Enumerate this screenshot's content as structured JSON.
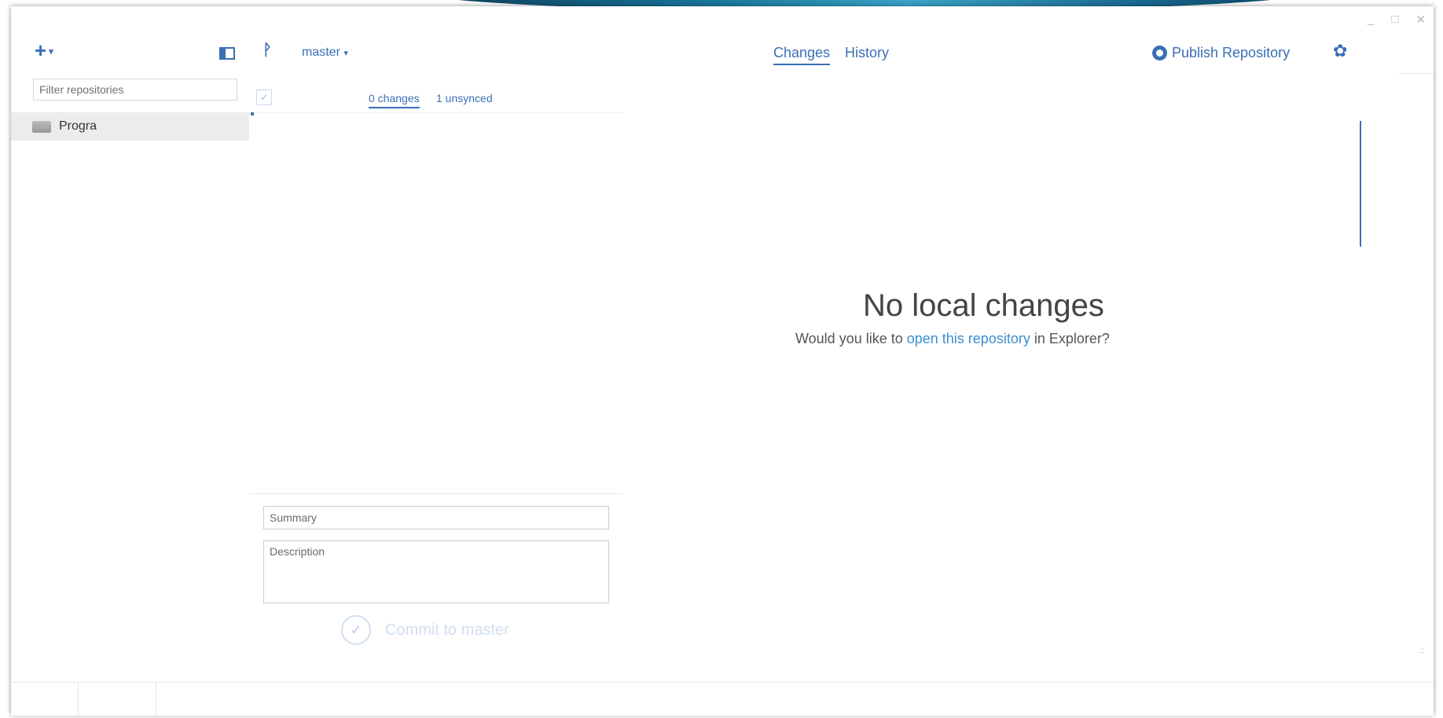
{
  "window_controls": {
    "minimize": "_",
    "maximize": "□",
    "close": "✕"
  },
  "sidebar": {
    "add_button": "+",
    "add_caret": "▾",
    "filter_placeholder": "Filter repositories",
    "repositories": [
      {
        "label": "Progra",
        "icon": "computer-icon"
      }
    ]
  },
  "branch": {
    "label": "master",
    "caret": "▾",
    "icon": "branch-icon"
  },
  "changes_panel": {
    "select_all_check": "✓",
    "tabs": [
      {
        "label": "0 changes",
        "active": true
      },
      {
        "label": "1 unsynced",
        "active": false
      }
    ]
  },
  "commit": {
    "summary_placeholder": "Summary",
    "description_placeholder": "Description",
    "button_check": "✓",
    "button_label": "Commit to master"
  },
  "header": {
    "tabs": [
      {
        "label": "Changes",
        "active": true
      },
      {
        "label": "History",
        "active": false
      }
    ],
    "publish_label": "Publish Repository",
    "publish_icon": "github-icon",
    "settings_icon": "gear-icon",
    "settings_glyph": "✿"
  },
  "empty_state": {
    "title": "No local changes",
    "prompt_before": "Would you like to ",
    "prompt_link": "open this repository",
    "prompt_after": " in Explorer?"
  },
  "colors": {
    "accent": "#3b6fb6",
    "link": "#3b8ed0",
    "list_selected_bg": "#ececec"
  }
}
